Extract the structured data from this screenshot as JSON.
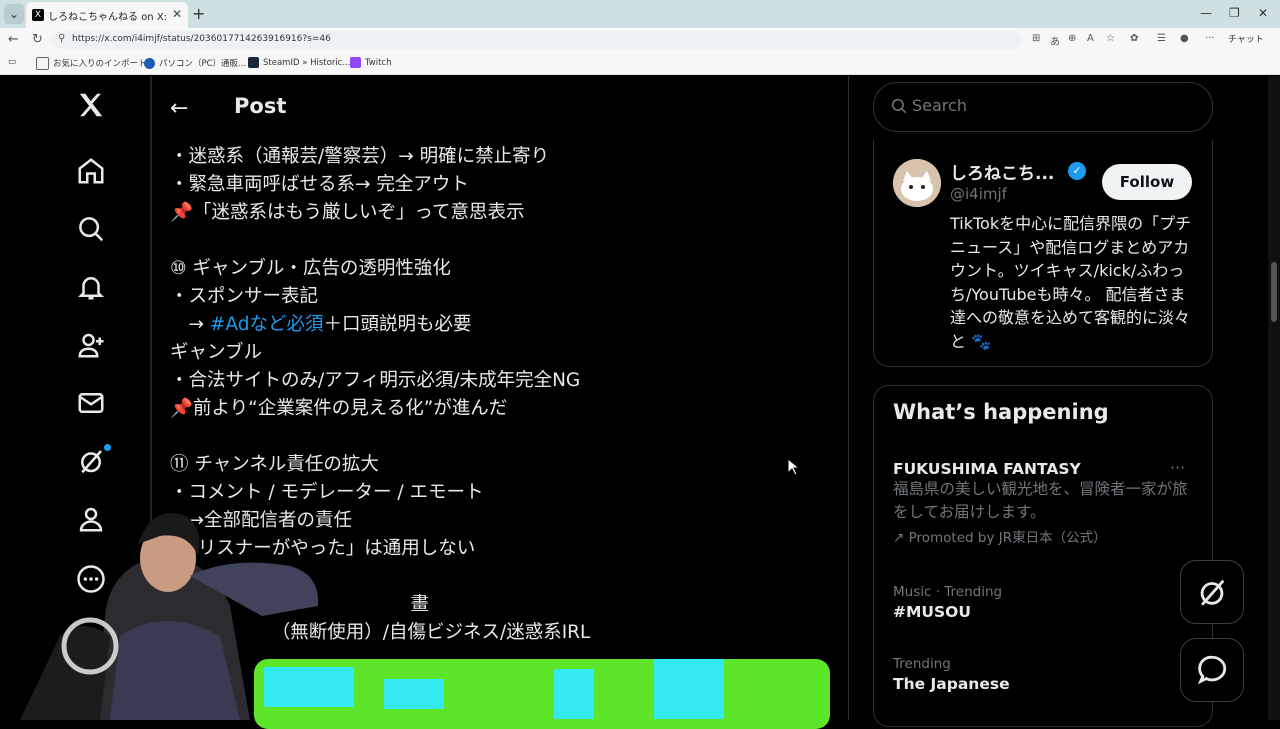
{
  "browser": {
    "tab_title": "しろねこちゃんねる on X: \"【KICK/規約",
    "tab_close": "✕",
    "new_tab": "+",
    "url": "https://x.com/i4imjf/status/2036017714263916916?s=46",
    "chat_label": "チャット",
    "bookmarks": [
      "お気に入りのインポート",
      "パソコン（PC）通販...",
      "SteamID » Historic...",
      "Twitch"
    ]
  },
  "header": {
    "back": "←",
    "title": "Post"
  },
  "post": {
    "lines": [
      "・迷惑系（通報芸/警察芸）→ 明確に禁止寄り",
      "・緊急車両呼ばせる系→ 完全アウト",
      "📌「迷惑系はもう厳しいぞ」って意思表示",
      "",
      "⑩ ギャンブル・広告の透明性強化",
      "・スポンサー表記"
    ],
    "hashtag_prefix": "　→ ",
    "hashtag": "#Adなど必須",
    "hashtag_suffix": "＋口頭説明も必要",
    "lines2": [
      "ギャンブル",
      "・合法サイトのみ/アフィ明示必須/未成年完全NG",
      "📌前より“企業案件の見える化”が進んだ",
      "",
      "⑪ チャンネル責任の拡大",
      "・コメント / モデレーター / エモート",
      "　→全部配信者の責任",
      "　「リスナーがやった」は通用しない",
      "",
      "　　　　　　　　　　　　　畫",
      "　　　　　　（無断使用）/自傷ビジネス/迷惑系IRL"
    ]
  },
  "search": {
    "placeholder": "Search"
  },
  "profile": {
    "name": "しろねこち...",
    "handle": "@i4imjf",
    "follow": "Follow",
    "bio": "TikTokを中心に配信界隈の「プチニュース」や配信ログまとめアカウント。ツイキャス/kick/ふわっち/YouTubeも時々。 配信者さま達への敬意を込めて客観的に淡々と 🐾"
  },
  "whats_happening": {
    "title": "What’s happening",
    "trends": [
      {
        "meta": "",
        "title": "FUKUSHIMA FANTASY",
        "desc": "福島県の美しい観光地を、冒険者一家が旅をしてお届けします。",
        "promo": "Promoted by JR東日本（公式）"
      },
      {
        "meta": "Music · Trending",
        "title": "#MUSOU"
      },
      {
        "meta": "Trending",
        "title": "The Japanese"
      }
    ],
    "more": "···"
  },
  "colors": {
    "accent": "#1d9bf0",
    "background": "#000000",
    "text": "#e7e9ea",
    "muted": "#71767b"
  }
}
